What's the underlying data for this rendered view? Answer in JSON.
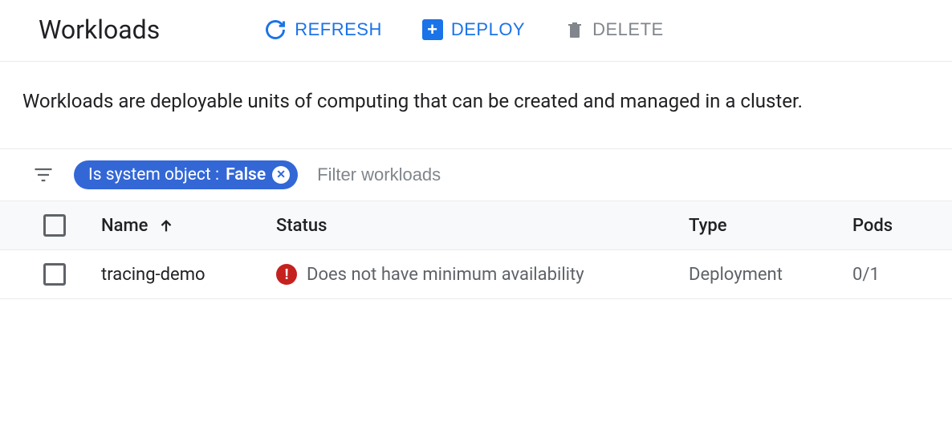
{
  "header": {
    "title": "Workloads",
    "refresh_label": "REFRESH",
    "deploy_label": "DEPLOY",
    "delete_label": "DELETE"
  },
  "description": "Workloads are deployable units of computing that can be created and managed in a cluster.",
  "filter": {
    "chip_key": "Is system object :",
    "chip_value": "False",
    "placeholder": "Filter workloads"
  },
  "columns": {
    "name": "Name",
    "status": "Status",
    "type": "Type",
    "pods": "Pods"
  },
  "rows": [
    {
      "name": "tracing-demo",
      "status": "Does not have minimum availability",
      "status_kind": "error",
      "type": "Deployment",
      "pods": "0/1"
    }
  ]
}
